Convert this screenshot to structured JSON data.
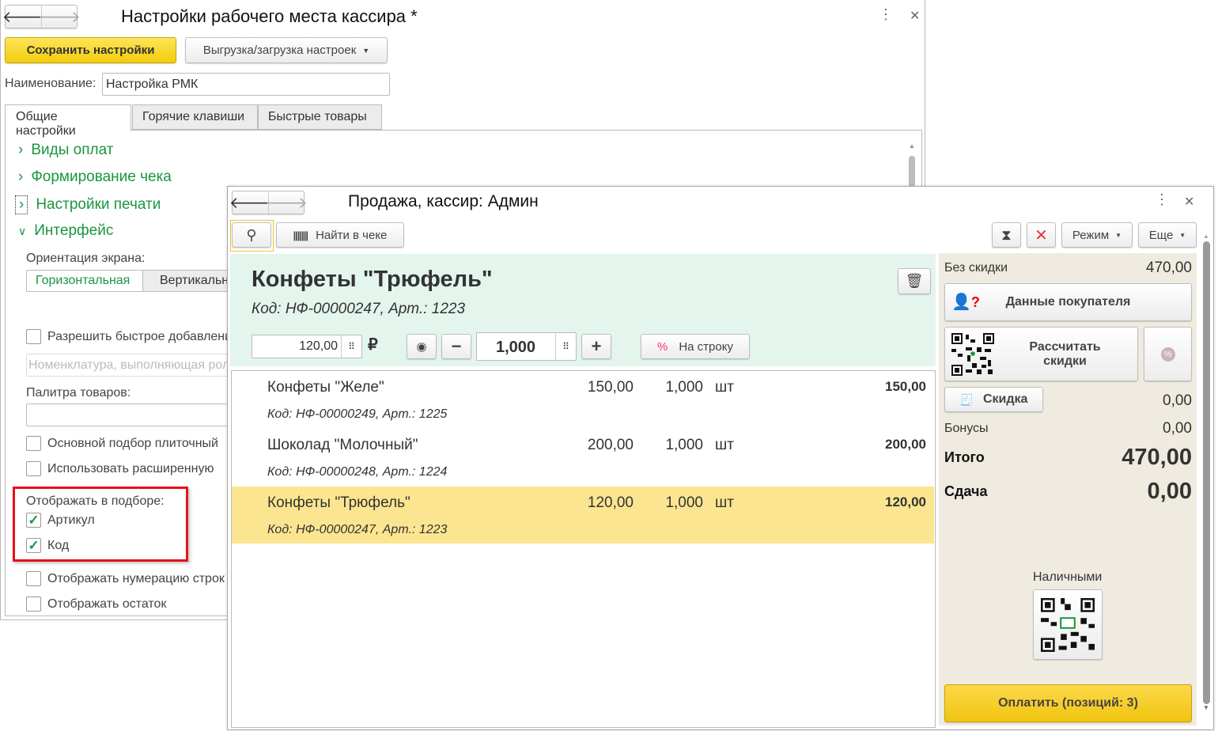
{
  "settings_window": {
    "title": "Настройки рабочего места кассира *",
    "save_label": "Сохранить настройки",
    "export_label": "Выгрузка/загрузка настроек",
    "name_label": "Наименование:",
    "name_value": "Настройка РМК",
    "tabs": [
      {
        "label": "Общие настройки"
      },
      {
        "label": "Горячие клавиши"
      },
      {
        "label": "Быстрые товары"
      }
    ],
    "sections": [
      {
        "label": "Виды оплат"
      },
      {
        "label": "Формирование чека"
      },
      {
        "label": "Настройки печати"
      },
      {
        "label": "Интерфейс"
      }
    ],
    "orientation_label": "Ориентация экрана:",
    "orientation_options": [
      "Горизонтальная",
      "Вертикальная"
    ],
    "quick_add_label": "Разрешить быстрое добавление",
    "nomenclature_placeholder": "Номенклатура, выполняющая роль",
    "palette_label": "Палитра товаров:",
    "tile_label": "Основной подбор плиточный",
    "extended_label": "Использовать расширенную",
    "display_label": "Отображать в подборе:",
    "article_label": "Артикул",
    "code_label": "Код",
    "numbering_label": "Отображать нумерацию строк",
    "stock_label": "Отображать остаток"
  },
  "sale_window": {
    "title": "Продажа, кассир: Админ",
    "find_label": "Найти в чеке",
    "mode_label": "Режим",
    "more_label": "Еще",
    "current": {
      "name": "Конфеты \"Трюфель\"",
      "code": "Код: НФ-00000247, Арт.: 1223",
      "price": "120,00",
      "currency": "₽",
      "qty": "1,000",
      "line_discount_label": "На строку"
    },
    "items": [
      {
        "name": "Конфеты \"Желе\"",
        "code": "Код: НФ-00000249, Арт.: 1225",
        "price": "150,00",
        "qty": "1,000",
        "unit": "шт",
        "sum": "150,00"
      },
      {
        "name": "Шоколад \"Молочный\"",
        "code": "Код: НФ-00000248, Арт.: 1224",
        "price": "200,00",
        "qty": "1,000",
        "unit": "шт",
        "sum": "200,00"
      },
      {
        "name": "Конфеты \"Трюфель\"",
        "code": "Код: НФ-00000247, Арт.: 1223",
        "price": "120,00",
        "qty": "1,000",
        "unit": "шт",
        "sum": "120,00"
      }
    ],
    "summary": {
      "no_discount_label": "Без скидки",
      "no_discount_value": "470,00",
      "customer_label": "Данные покупателя",
      "calc_label_1": "Рассчитать",
      "calc_label_2": "скидки",
      "discount_label": "Скидка",
      "discount_value": "0,00",
      "bonus_label": "Бонусы",
      "bonus_value": "0,00",
      "total_label": "Итого",
      "total_value": "470,00",
      "change_label": "Сдача",
      "change_value": "0,00",
      "cash_label": "Наличными",
      "pay_label": "Оплатить (позиций: 3)"
    }
  }
}
